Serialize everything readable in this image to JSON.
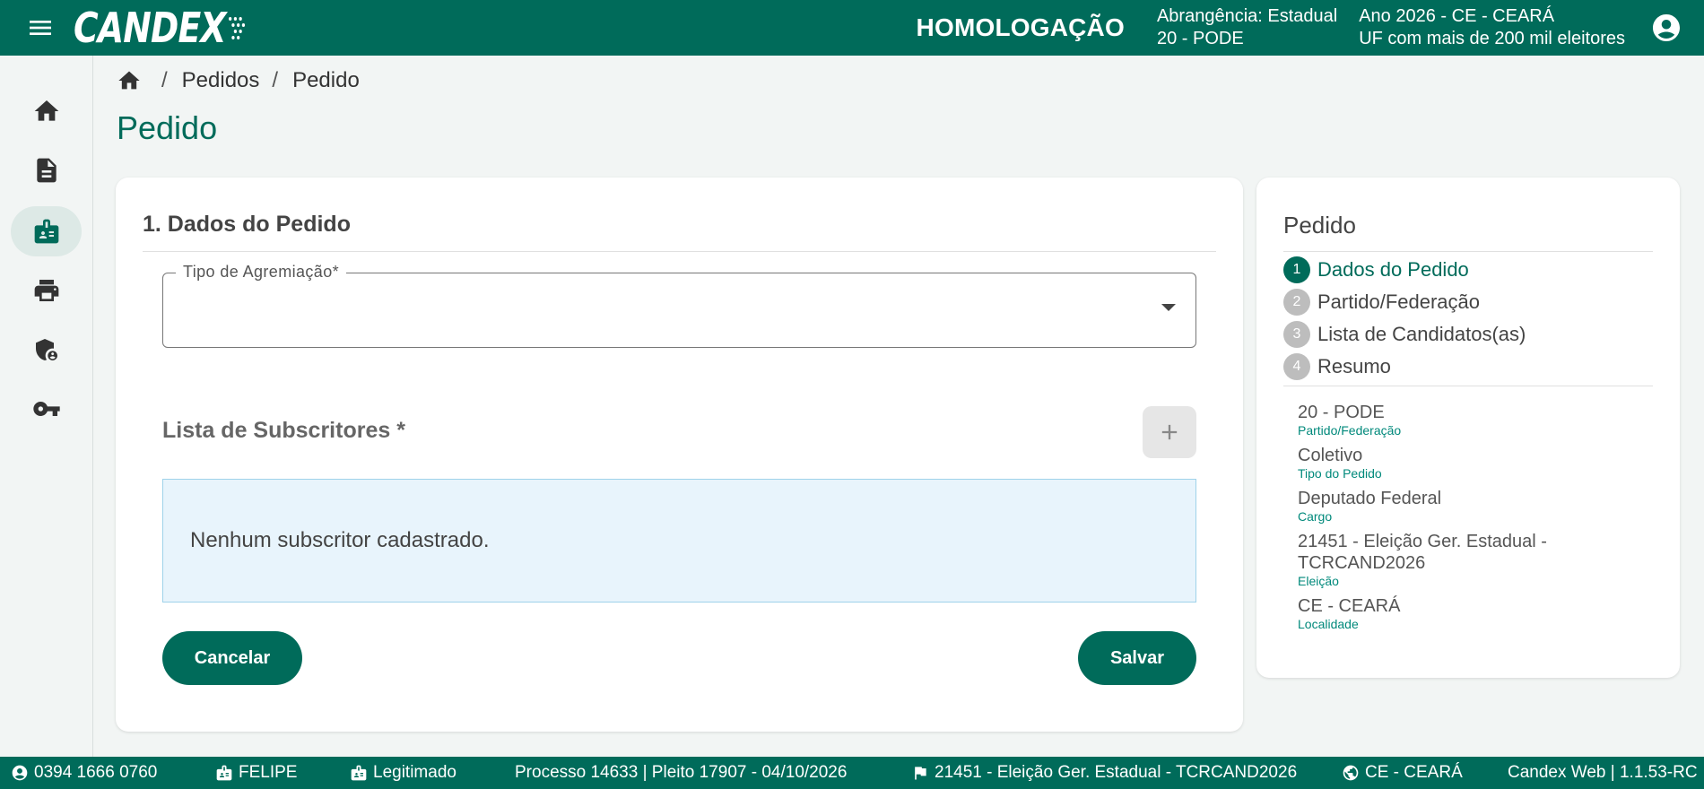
{
  "header": {
    "logo": "CANDEX",
    "environment": "HOMOLOGAÇÃO",
    "abrangencia_line1": "Abrangência: Estadual",
    "abrangencia_line2": "20 - PODE",
    "ano_line1": "Ano 2026 - CE - CEARÁ",
    "ano_line2": "UF com mais de 200 mil eleitores"
  },
  "sidebar": {
    "items": [
      {
        "icon": "home-icon"
      },
      {
        "icon": "document-icon"
      },
      {
        "icon": "badge-icon",
        "active": true
      },
      {
        "icon": "printer-icon"
      },
      {
        "icon": "shield-user-icon"
      },
      {
        "icon": "key-icon"
      }
    ]
  },
  "breadcrumb": {
    "items": [
      "Pedidos",
      "Pedido"
    ],
    "separator": "/"
  },
  "page": {
    "title": "Pedido"
  },
  "form": {
    "section_title": "1. Dados do Pedido",
    "tipo_agremiacao_label": "Tipo de Agremiação*",
    "tipo_agremiacao_value": "",
    "subscritores_title": "Lista de Subscritores *",
    "empty_message": "Nenhum subscritor cadastrado.",
    "cancel_label": "Cancelar",
    "save_label": "Salvar"
  },
  "side_panel": {
    "title": "Pedido",
    "steps": [
      {
        "num": "1",
        "label": "Dados do Pedido",
        "active": true
      },
      {
        "num": "2",
        "label": "Partido/Federação"
      },
      {
        "num": "3",
        "label": "Lista de Candidatos(as)"
      },
      {
        "num": "4",
        "label": "Resumo"
      }
    ],
    "summary": [
      {
        "value": "20 - PODE",
        "label": "Partido/Federação"
      },
      {
        "value": "Coletivo",
        "label": "Tipo do Pedido"
      },
      {
        "value": "Deputado Federal",
        "label": "Cargo"
      },
      {
        "value": "21451 - Eleição Ger. Estadual - TCRCAND2026",
        "label": "Eleição"
      },
      {
        "value": "CE - CEARÁ",
        "label": "Localidade"
      }
    ]
  },
  "footer": {
    "user_id": "0394 1666 0760",
    "user_name": "FELIPE",
    "role": "Legitimado",
    "processo": "Processo 14633 | Pleito 17907 - 04/10/2026",
    "eleicao": "21451 - Eleição Ger. Estadual - TCRCAND2026",
    "localidade": "CE - CEARÁ",
    "version": "Candex Web | 1.1.53-RC"
  },
  "colors": {
    "primary": "#006b5a",
    "background": "#f2f5f4",
    "info_box": "#e8f4fc"
  }
}
